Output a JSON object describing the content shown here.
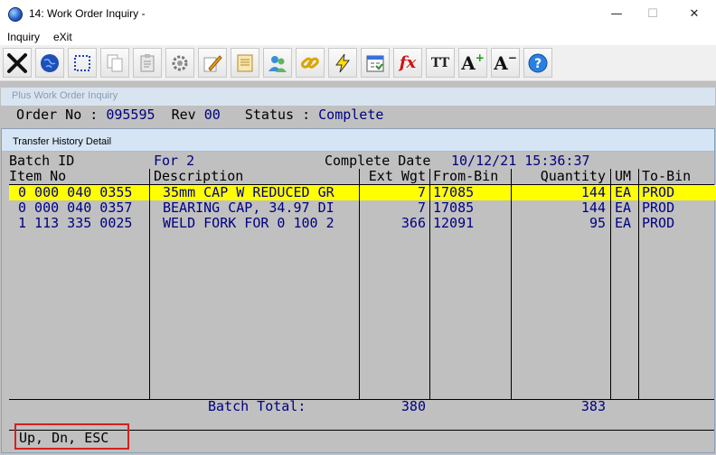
{
  "window": {
    "title": "14: Work Order Inquiry -",
    "controls": {
      "minimize": "—",
      "maximize": "☐",
      "close": "✕"
    }
  },
  "menu": {
    "inquiry": "Inquiry",
    "exit": "eXit"
  },
  "toolbar": {
    "buttons": [
      "close-icon",
      "globe-icon",
      "select-icon",
      "copy-icon",
      "paste-icon",
      "settings-icon",
      "edit-icon",
      "notes-icon",
      "users-icon",
      "link-icon",
      "lightning-icon",
      "calendar-icon",
      "function-icon",
      "font-size-icon",
      "font-increase-icon",
      "font-decrease-icon",
      "help-icon"
    ],
    "fx_label": "fx",
    "tt_label": "TT",
    "a_label": "A"
  },
  "main": {
    "caption": "Plus Work Order Inquiry",
    "order_no_label": "Order No :",
    "order_no": "095595",
    "rev_label": "Rev",
    "rev": "00",
    "status_label": "Status :",
    "status": "Complete"
  },
  "dialog": {
    "caption": "Transfer History Detail",
    "batch_id_label": "Batch ID",
    "batch_id": "For 2",
    "complete_date_label": "Complete Date",
    "complete_date": "10/12/21 15:36:37",
    "columns": [
      "Item No",
      "Description",
      "Ext Wgt",
      "From-Bin",
      "Quantity",
      "UM",
      "To-Bin"
    ],
    "rows": [
      {
        "item_no": "0 000 040 0355",
        "description": "35mm CAP W REDUCED GR",
        "ext_wgt": "7",
        "from_bin": "17085",
        "quantity": "144",
        "um": "EA",
        "to_bin": "PROD"
      },
      {
        "item_no": "0 000 040 0357",
        "description": "BEARING CAP, 34.97 DI",
        "ext_wgt": "7",
        "from_bin": "17085",
        "quantity": "144",
        "um": "EA",
        "to_bin": "PROD"
      },
      {
        "item_no": "1 113 335 0025",
        "description": "WELD FORK FOR 0 100 2",
        "ext_wgt": "366",
        "from_bin": "12091",
        "quantity": "95",
        "um": "EA",
        "to_bin": "PROD"
      }
    ],
    "batch_total_label": "Batch Total:",
    "total_wgt": "380",
    "total_qty": "383",
    "status_text": "Up, Dn, ESC"
  },
  "colors": {
    "highlight": "#ffff00",
    "value_text": "#000080",
    "status_box": "#d42020"
  }
}
